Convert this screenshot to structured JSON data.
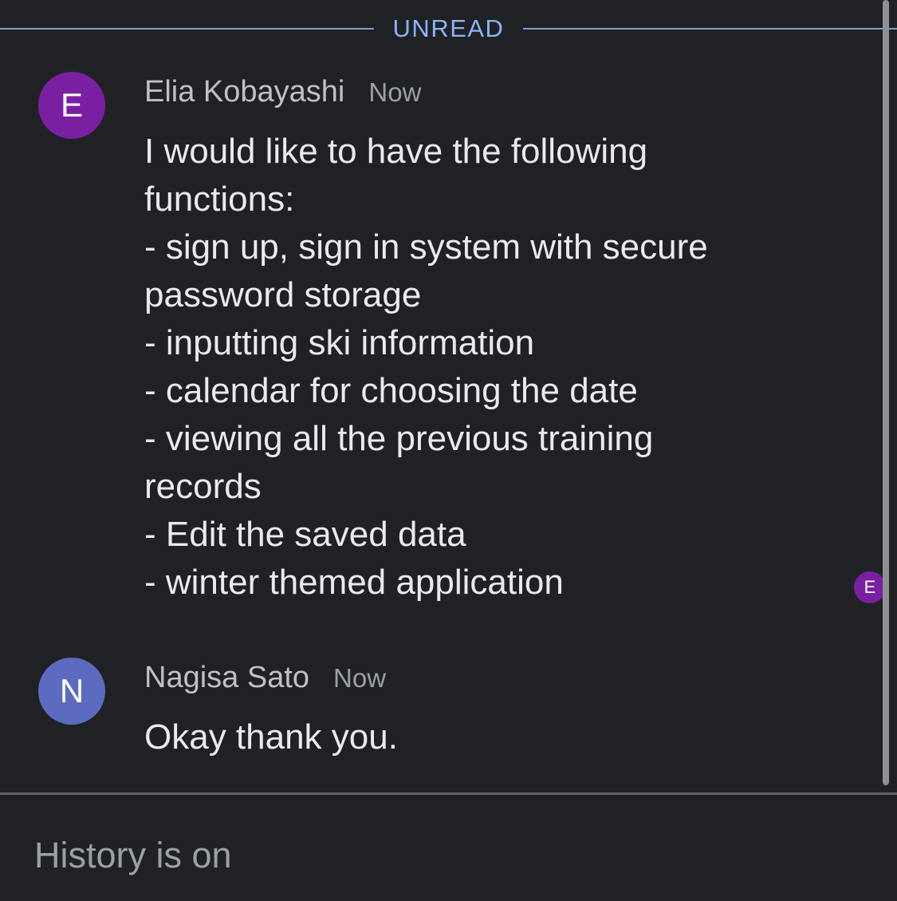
{
  "unread_divider": {
    "label": "UNREAD"
  },
  "messages": [
    {
      "avatar_initial": "E",
      "avatar_color": "#7b1fa2",
      "sender": "Elia Kobayashi",
      "time": "Now",
      "lines": [
        "I would like to have the following",
        "functions:",
        "- sign up, sign in system with secure",
        "password storage",
        "- inputting ski information",
        "- calendar for choosing the date",
        "- viewing all the previous training",
        "records",
        "- Edit the saved data",
        "- winter themed application"
      ]
    },
    {
      "avatar_initial": "N",
      "avatar_color": "#5c6bc0",
      "sender": "Nagisa Sato",
      "time": "Now",
      "lines": [
        "Okay thank you."
      ]
    }
  ],
  "read_receipt": {
    "initial": "E",
    "color": "#7b1fa2"
  },
  "footer": {
    "history_status": "History is on"
  },
  "colors": {
    "background": "#202124",
    "accent": "#8ab4f8",
    "divider": "#5f6368"
  }
}
